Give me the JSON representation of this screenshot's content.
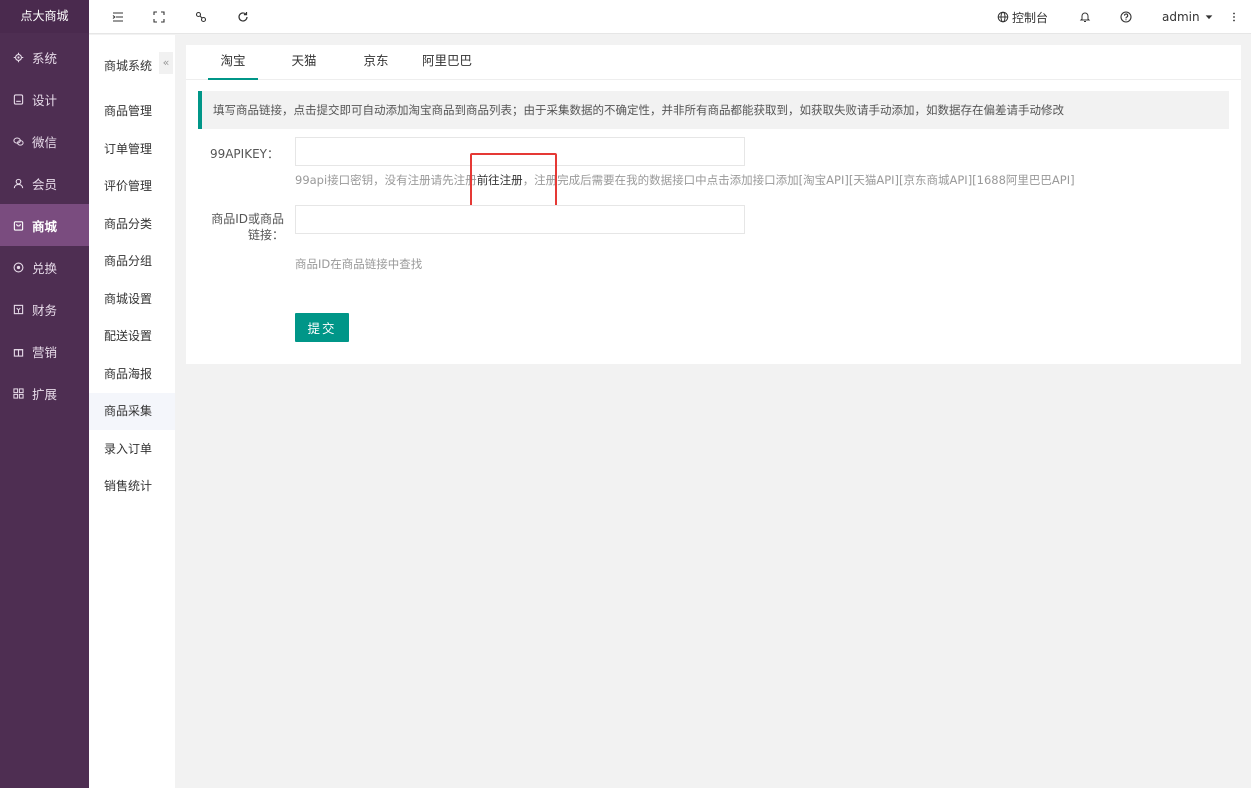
{
  "brand": "点大商城",
  "sidebar": {
    "items": [
      {
        "label": "系统",
        "icon": "gear-icon"
      },
      {
        "label": "设计",
        "icon": "design-icon"
      },
      {
        "label": "微信",
        "icon": "wechat-icon"
      },
      {
        "label": "会员",
        "icon": "user-icon"
      },
      {
        "label": "商城",
        "icon": "shop-icon",
        "active": true
      },
      {
        "label": "兑换",
        "icon": "exchange-icon"
      },
      {
        "label": "财务",
        "icon": "finance-icon"
      },
      {
        "label": "营销",
        "icon": "gift-icon"
      },
      {
        "label": "扩展",
        "icon": "apps-icon"
      }
    ]
  },
  "topbar": {
    "console_label": "控制台",
    "user": "admin"
  },
  "submenu": {
    "title": "商城系统",
    "collapse_glyph": "«",
    "items": [
      "商品管理",
      "订单管理",
      "评价管理",
      "商品分类",
      "商品分组",
      "商城设置",
      "配送设置",
      "商品海报",
      "商品采集",
      "录入订单",
      "销售统计"
    ],
    "active_index": 8
  },
  "tabs": [
    "淘宝",
    "天猫",
    "京东",
    "阿里巴巴"
  ],
  "notice": "填写商品链接，点击提交即可自动添加淘宝商品到商品列表；由于采集数据的不确定性，并非所有商品都能获取到，如获取失败请手动添加，如数据存在偏差请手动修改",
  "form": {
    "apikey_label": "99APIKEY：",
    "apikey_value": "",
    "apikey_help_prefix": "99api接口密钥，没有注册请先注册",
    "apikey_help_link": "前往注册",
    "apikey_help_suffix": "，注册完成后需要在我的数据接口中点击添加接口添加[淘宝API][天猫API][京东商城API][1688阿里巴巴API]",
    "goods_label_line1": "商品ID或商品",
    "goods_label_line2": "链接：",
    "goods_value": "",
    "goods_help": "商品ID在商品链接中查找",
    "submit_label": "提交"
  },
  "colors": {
    "sidebar_bg": "#4e2e52",
    "sidebar_active": "#7a4c7f",
    "accent": "#009688",
    "highlight": "#e53935"
  }
}
